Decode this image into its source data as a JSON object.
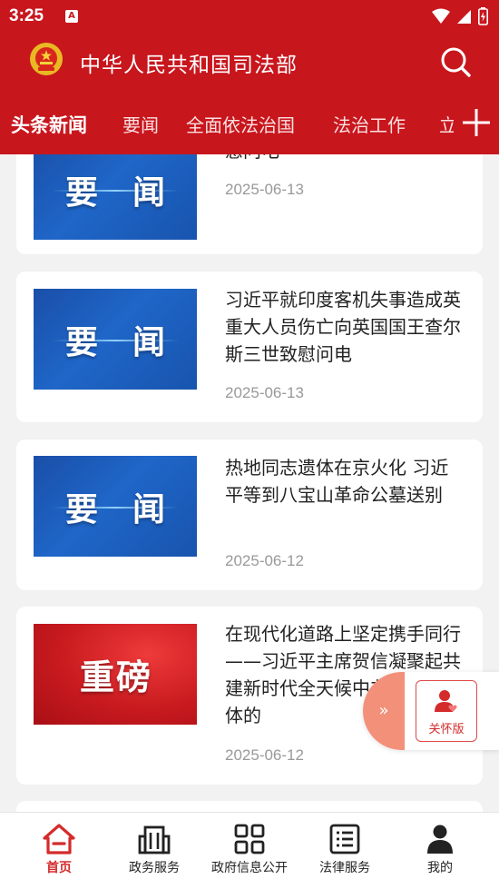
{
  "status": {
    "time": "3:25",
    "badge": "A"
  },
  "header": {
    "title": "中华人民共和国司法部"
  },
  "tabs": [
    {
      "label": "头条新闻",
      "active": true
    },
    {
      "label": "要闻",
      "active": false
    },
    {
      "label": "全面依法治国",
      "active": false
    },
    {
      "label": "法治工作",
      "active": false
    },
    {
      "label": "立",
      "active": false
    }
  ],
  "feed": {
    "cards": [
      {
        "badge": [
          "要",
          "闻"
        ],
        "theme": "blue",
        "title": "印度总统穆尔穆、总理莫迪致慰问电",
        "date": "2025-06-13"
      },
      {
        "badge": [
          "要",
          "闻"
        ],
        "theme": "blue",
        "title": "习近平就印度客机失事造成英重大人员伤亡向英国国王查尔斯三世致慰问电",
        "date": "2025-06-13"
      },
      {
        "badge": [
          "要",
          "闻"
        ],
        "theme": "blue",
        "title": "热地同志遗体在京火化 习近平等到八宝山革命公墓送别",
        "date": "2025-06-12"
      },
      {
        "badge": [
          "重",
          "磅"
        ],
        "theme": "red",
        "title": "在现代化道路上坚定携手同行——习近平主席贺信凝聚起共建新时代全天候中非命运共同体的",
        "date": "2025-06-12"
      }
    ]
  },
  "care_mode": {
    "arrow": "»",
    "label": "关怀版"
  },
  "bottom_nav": [
    {
      "label": "首页",
      "icon": "home-icon",
      "active": true
    },
    {
      "label": "政务服务",
      "icon": "building-icon",
      "active": false
    },
    {
      "label": "政府信息公开",
      "icon": "grid-icon",
      "active": false
    },
    {
      "label": "法律服务",
      "icon": "list-icon",
      "active": false
    },
    {
      "label": "我的",
      "icon": "user-icon",
      "active": false
    }
  ],
  "colors": {
    "brand_red": "#c8161d",
    "active_nav": "#d42b2b",
    "date_gray": "#999999"
  }
}
